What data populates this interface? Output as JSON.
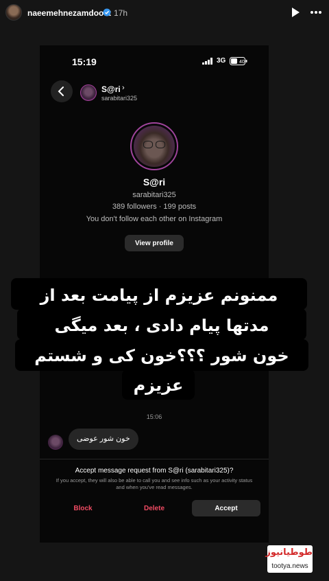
{
  "story": {
    "username": "naeemehnezamdoost",
    "time": "17h"
  },
  "phone": {
    "status_time": "15:19",
    "network": "3G",
    "battery": "40",
    "thread": {
      "name": "S@ri",
      "chevron": "›",
      "handle": "sarabitari325"
    },
    "profile": {
      "name": "S@ri",
      "handle": "sarabitari325",
      "stats": "389 followers · 199 posts",
      "follow_note": "You don't follow each other on Instagram",
      "view_profile_label": "View profile"
    },
    "message_time": "15:06",
    "message_text": "خون شور عوضی",
    "request": {
      "title": "Accept message request from S@ri (sarabitari325)?",
      "description": "If you accept, they will also be able to call you and see info such as your activity status and when you've read messages.",
      "block_label": "Block",
      "delete_label": "Delete",
      "accept_label": "Accept"
    }
  },
  "caption": {
    "lines": [
      "ممنونم عزیزم از پیامت بعد از",
      "مدتها پیام دادی ، بعد میگی",
      "خون شور ؟؟؟خون کی و شستم",
      "عزیزم"
    ]
  },
  "watermark": {
    "brand": "طوطیانیوز",
    "domain": "tootya.news"
  },
  "colors": {
    "background": "#151515",
    "destructive": "#f04b63",
    "avatar_ring": "#a0449c"
  }
}
